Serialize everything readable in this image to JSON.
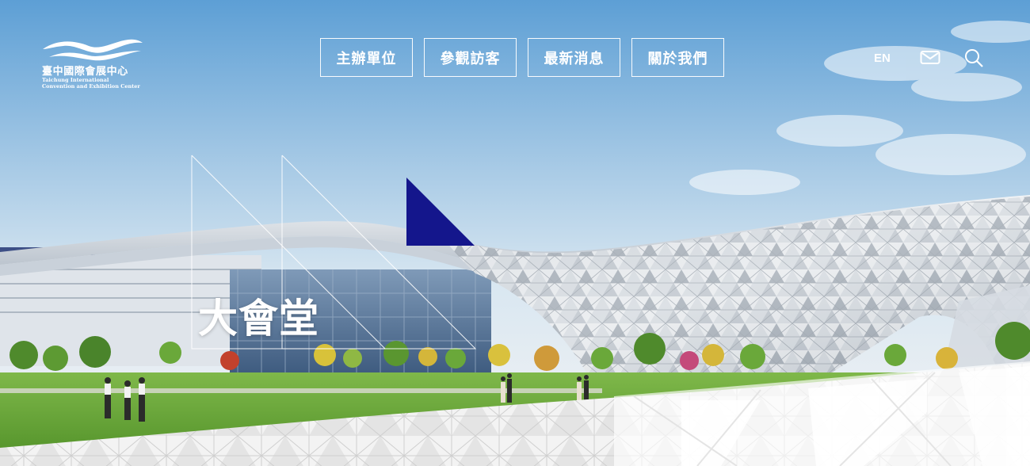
{
  "header": {
    "logo": {
      "name_cn": "臺中國際會展中心",
      "name_en_line1": "Taichung International",
      "name_en_line2": "Convention and Exhibition Center"
    },
    "nav": [
      {
        "label": "主辦單位"
      },
      {
        "label": "參觀訪客"
      },
      {
        "label": "最新消息"
      },
      {
        "label": "關於我們"
      }
    ],
    "utility": {
      "language": "EN",
      "mail_icon": "envelope-icon",
      "search_icon": "search-icon"
    }
  },
  "hero": {
    "title": "大會堂"
  },
  "colors": {
    "sky": "#6fa6d6",
    "accent": "#14168c",
    "lawn": "#6aa83a",
    "nav_border": "#ffffff"
  }
}
